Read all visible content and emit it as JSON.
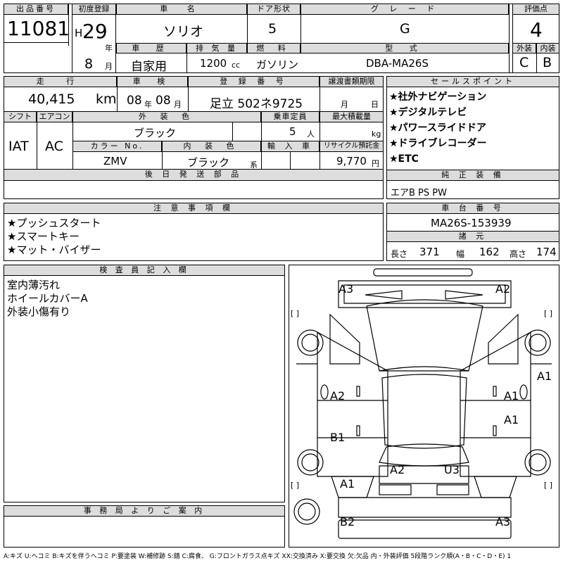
{
  "header": {
    "lot_label": "出品番号",
    "lot_number": "11081",
    "first_reg_label": "初度登録",
    "era": "H",
    "year": "29",
    "year_unit": "年",
    "month": "8",
    "month_unit": "月",
    "car_name_label": "車 名",
    "car_name": "ソリオ",
    "door_label": "ドア形状",
    "doors": "5",
    "grade_label": "グ レ ー ド",
    "grade": "G",
    "score_label": "評価点",
    "score": "4",
    "history_label": "車 歴",
    "history": "自家用",
    "displacement_label": "排 気 量",
    "displacement": "1200",
    "displacement_unit": "cc",
    "fuel_label": "燃 料",
    "fuel": "ガソリン",
    "model_label": "型 式",
    "model": "DBA-MA26S",
    "exterior_label": "外装",
    "exterior_grade": "C",
    "interior_label": "内装",
    "interior_grade": "B"
  },
  "info": {
    "mileage_label": "走 行",
    "mileage": "40,415",
    "mileage_unit": "km",
    "inspection_label": "車 検",
    "inspection_year": "08",
    "inspection_month": "08",
    "year_unit": "年",
    "month_unit": "月",
    "reg_no_label": "登 録 番 号",
    "reg_no": "足立 502ネ9725",
    "transfer_label": "譲渡書類期限",
    "transfer_month": "月",
    "transfer_day": "日",
    "shift_label": "シフト",
    "shift": "IAT",
    "ac_label": "エアコン",
    "ac": "AC",
    "color_label": "外 装 色",
    "color": "ブラック",
    "capacity_label": "乗車定員",
    "capacity": "5",
    "capacity_unit": "人",
    "load_label": "最大積載量",
    "load_unit": "kg",
    "color_no_label": "カラー No.",
    "color_no": "ZMV",
    "int_color_label": "内 装 色",
    "int_color": "ブラック",
    "int_color_unit": "系",
    "import_label": "輸 入 車",
    "recycle_label": "リサイクル預託金",
    "recycle": "9,770",
    "recycle_unit": "円",
    "later_label": "後 日 発 送 部 品"
  },
  "sales": {
    "label": "セールスポイント",
    "items": [
      "★社外ナビゲーション",
      "★デジタルテレビ",
      "★パワースライドドア",
      "★ドライブレコーダー",
      "★ETC"
    ]
  },
  "equipment": {
    "label": "純 正 装 備",
    "value": "エアB PS PW"
  },
  "notes": {
    "label": "注 意 事 項 欄",
    "items": [
      "★プッシュスタート",
      "★スマートキー",
      "★マット・バイザー"
    ]
  },
  "chassis": {
    "label": "車 台 番 号",
    "value": "MA26S-153939"
  },
  "specs": {
    "label": "諸 元",
    "length_label": "長さ",
    "length": "371",
    "width_label": "幅",
    "width": "162",
    "height_label": "高さ",
    "height": "174"
  },
  "inspector": {
    "label": "検 査 員 記 入 欄",
    "lines": [
      "室内薄汚れ",
      "ホイールカバーA",
      "外装小傷有り"
    ]
  },
  "office": {
    "label": "事 務 局 よ り ご 案 内"
  },
  "diagram": {
    "labels": [
      "A3",
      "A2",
      "A1",
      "A2",
      "A1",
      "A1",
      "B1",
      "A2",
      "U3",
      "A1",
      "B2",
      "A3"
    ],
    "bracket": "[ ]"
  },
  "legend": "A:キズ U:ヘコミ B:キズを伴うヘコミ P:要塗装 W:補修跡 S:錆 C:腐食、 G:フロントガラス点キズ XX:交換済み X:要交換 欠:欠品 内・外装評価 5段階ランク順(A・B・C・D・E) 1"
}
